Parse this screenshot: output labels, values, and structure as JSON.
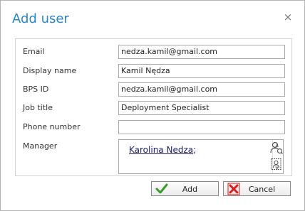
{
  "dialog": {
    "title": "Add user",
    "close_glyph": "×"
  },
  "form": {
    "email": {
      "label": "Email",
      "value": "nedza.kamil@gmail.com"
    },
    "display_name": {
      "label": "Display name",
      "value": "Kamil Nędza"
    },
    "bps_id": {
      "label": "BPS ID",
      "value": "nedza.kamil@gmail.com"
    },
    "job_title": {
      "label": "Job title",
      "value": "Deployment Specialist"
    },
    "phone": {
      "label": "Phone number",
      "value": ""
    },
    "manager": {
      "label": "Manager",
      "name": "Karolina Nedza",
      "separator": ";",
      "lookup_icon": "user-search-icon",
      "browse_icon": "address-book-icon"
    }
  },
  "buttons": {
    "add": {
      "label": "Add",
      "icon": "check-icon",
      "icon_color": "#3a9b2a"
    },
    "cancel": {
      "label": "Cancel",
      "icon": "x-icon",
      "icon_color": "#d02020"
    }
  },
  "colors": {
    "title": "#2a86c8"
  }
}
